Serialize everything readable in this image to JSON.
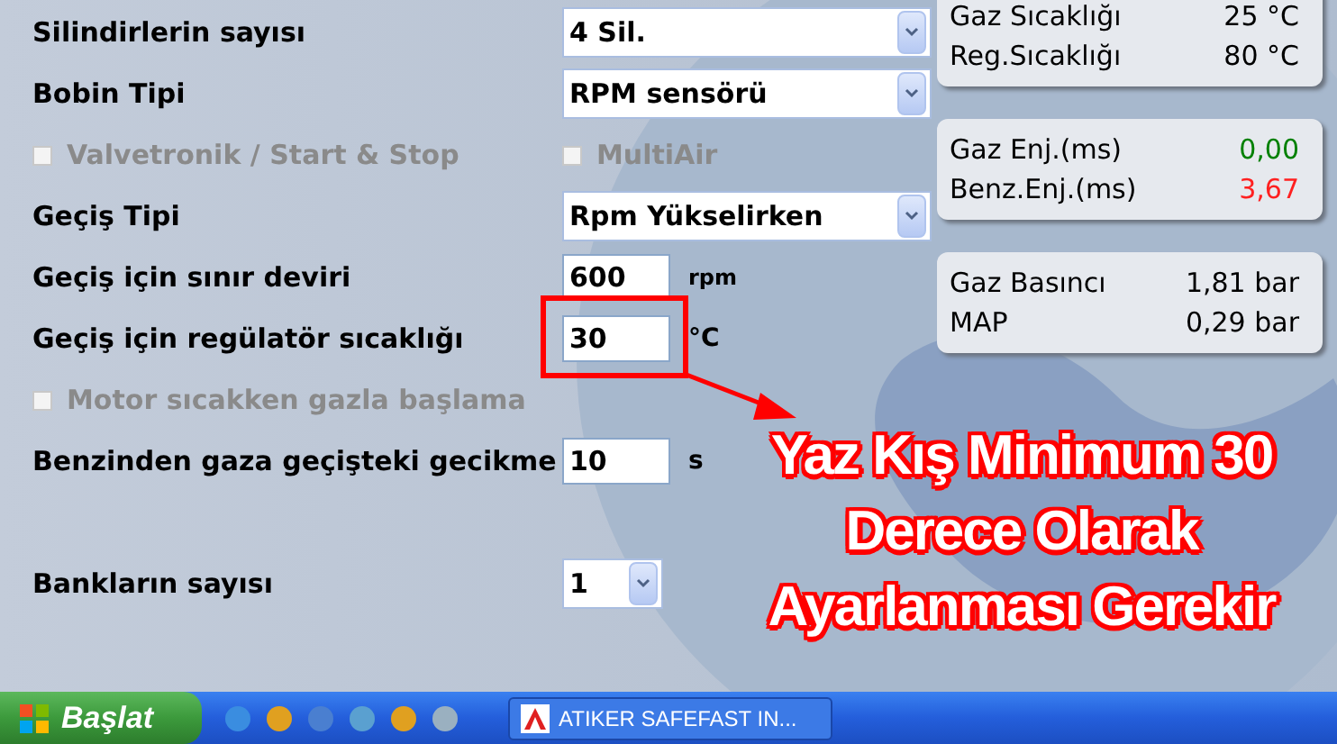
{
  "form": [
    {
      "kind": "select",
      "label": "Silindirlerin sayısı",
      "value": "4 Sil."
    },
    {
      "kind": "select",
      "label": "Bobin Tipi",
      "value": "RPM sensörü"
    },
    {
      "kind": "checks",
      "items": [
        {
          "label": "Valvetronik / Start & Stop",
          "checked": false,
          "disabled": true
        },
        {
          "label": "MultiAir",
          "checked": false,
          "disabled": true
        }
      ]
    },
    {
      "kind": "select",
      "label": "Geçiş Tipi",
      "value": "Rpm Yükselirken"
    },
    {
      "kind": "input",
      "label": "Geçiş için sınır deviri",
      "value": "600",
      "unit": "rpm"
    },
    {
      "kind": "input",
      "label": "Geçiş için regülatör sıcaklığı",
      "value": "30",
      "unit": "°C"
    },
    {
      "kind": "checks",
      "items": [
        {
          "label": "Motor sıcakken gazla başlama",
          "checked": false,
          "disabled": true
        }
      ]
    },
    {
      "kind": "input",
      "label": "Benzinden gaza geçişteki gecikme",
      "value": "10",
      "unit": "s"
    },
    {
      "kind": "spacer"
    },
    {
      "kind": "small-select",
      "label": "Bankların sayısı",
      "value": "1"
    }
  ],
  "panels": [
    {
      "rows": [
        {
          "label": "Gaz Sıcaklığı",
          "value": "25 °C",
          "color": "#000000"
        },
        {
          "label": "Reg.Sıcaklığı",
          "value": "80 °C",
          "color": "#000000"
        }
      ]
    },
    {
      "rows": [
        {
          "label": "Gaz Enj.(ms)",
          "value": "0,00",
          "color": "#008000"
        },
        {
          "label": "Benz.Enj.(ms)",
          "value": "3,67",
          "color": "#ff2020"
        }
      ]
    },
    {
      "rows": [
        {
          "label": "Gaz Basıncı",
          "value": "1,81 bar",
          "color": "#000000"
        },
        {
          "label": "MAP",
          "value": "0,29 bar",
          "color": "#000000"
        }
      ]
    }
  ],
  "annotation": {
    "lines": [
      "Yaz Kış Minimum 30",
      "Derece Olarak",
      "Ayarlanması Gerekir"
    ]
  },
  "taskbar": {
    "start": "Başlat",
    "task": "ATIKER SAFEFAST IN..."
  }
}
